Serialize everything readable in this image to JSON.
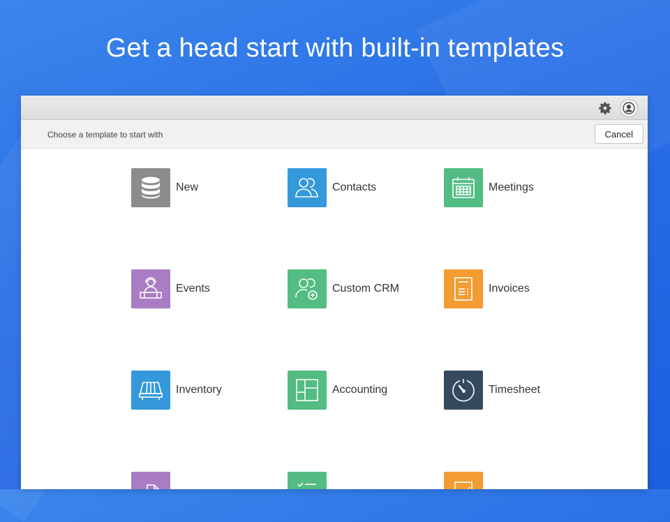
{
  "headline": "Get a head start with built-in templates",
  "window": {
    "subbar_label": "Choose a template to start with",
    "cancel_label": "Cancel"
  },
  "toolbar_icons": [
    "gear-icon",
    "user-icon"
  ],
  "templates": [
    {
      "label": "New",
      "icon": "database-icon",
      "color": "#8c8c8c"
    },
    {
      "label": "Contacts",
      "icon": "contacts-icon",
      "color": "#3498db"
    },
    {
      "label": "Meetings",
      "icon": "calendar-icon",
      "color": "#52bc82"
    },
    {
      "label": "Events",
      "icon": "events-icon",
      "color": "#a97cc4"
    },
    {
      "label": "Custom CRM",
      "icon": "add-contact-icon",
      "color": "#52bc82"
    },
    {
      "label": "Invoices",
      "icon": "invoice-icon",
      "color": "#f39c32"
    },
    {
      "label": "Inventory",
      "icon": "pallet-icon",
      "color": "#3498db"
    },
    {
      "label": "Accounting",
      "icon": "ledger-icon",
      "color": "#52bc82"
    },
    {
      "label": "Timesheet",
      "icon": "timer-icon",
      "color": "#34495e"
    },
    {
      "label": "",
      "icon": "tag-icon",
      "color": "#a97cc4"
    },
    {
      "label": "",
      "icon": "checklist-icon",
      "color": "#52bc82"
    },
    {
      "label": "",
      "icon": "chart-icon",
      "color": "#f39c32"
    }
  ]
}
